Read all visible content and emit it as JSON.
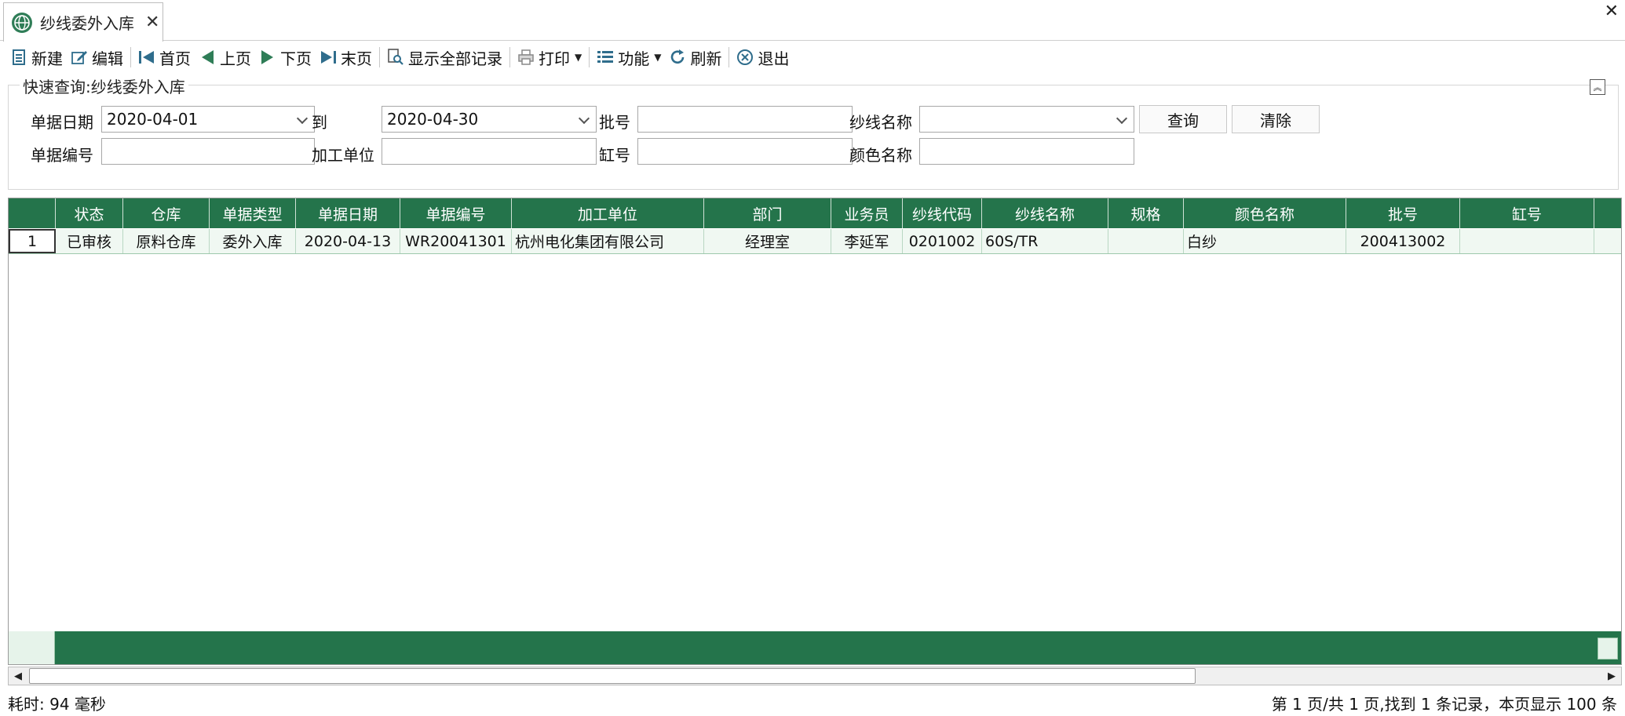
{
  "tab": {
    "title": "纱线委外入库",
    "close_glyph": "✕"
  },
  "window": {
    "close_glyph": "✕"
  },
  "toolbar": {
    "new": "新建",
    "edit": "编辑",
    "first": "首页",
    "prev": "上页",
    "next": "下页",
    "last": "末页",
    "show_all": "显示全部记录",
    "print": "打印",
    "function": "功能",
    "refresh": "刷新",
    "exit": "退出"
  },
  "query": {
    "title": "快速查询:纱线委外入库",
    "date_label": "单据日期",
    "date_from": "2020-04-01",
    "to_label": "到",
    "date_to": "2020-04-30",
    "batch_label": "批号",
    "batch_value": "",
    "yarn_name_label": "纱线名称",
    "yarn_name_value": "",
    "search_button": "查询",
    "clear_button": "清除",
    "doc_no_label": "单据编号",
    "doc_no_value": "",
    "processor_label": "加工单位",
    "processor_value": "",
    "vat_label": "缸号",
    "vat_value": "",
    "color_label": "颜色名称",
    "color_value": ""
  },
  "grid": {
    "columns": [
      "",
      "状态",
      "仓库",
      "单据类型",
      "单据日期",
      "单据编号",
      "加工单位",
      "部门",
      "业务员",
      "纱线代码",
      "纱线名称",
      "规格",
      "颜色名称",
      "批号",
      "缸号",
      ""
    ],
    "rows": [
      [
        "1",
        "已审核",
        "原料仓库",
        "委外入库",
        "2020-04-13",
        "WR20041301",
        "杭州电化集团有限公司",
        "经理室",
        "李延军",
        "0201002",
        "60S/TR",
        "",
        "白纱",
        "200413002",
        "",
        ""
      ]
    ]
  },
  "status": {
    "elapsed": "耗时: 94 毫秒",
    "paging": "第 1 页/共 1 页,找到 1 条记录，本页显示 100 条"
  },
  "colors": {
    "accent_green": "#24744b",
    "row_bg": "#f0f8f2"
  }
}
